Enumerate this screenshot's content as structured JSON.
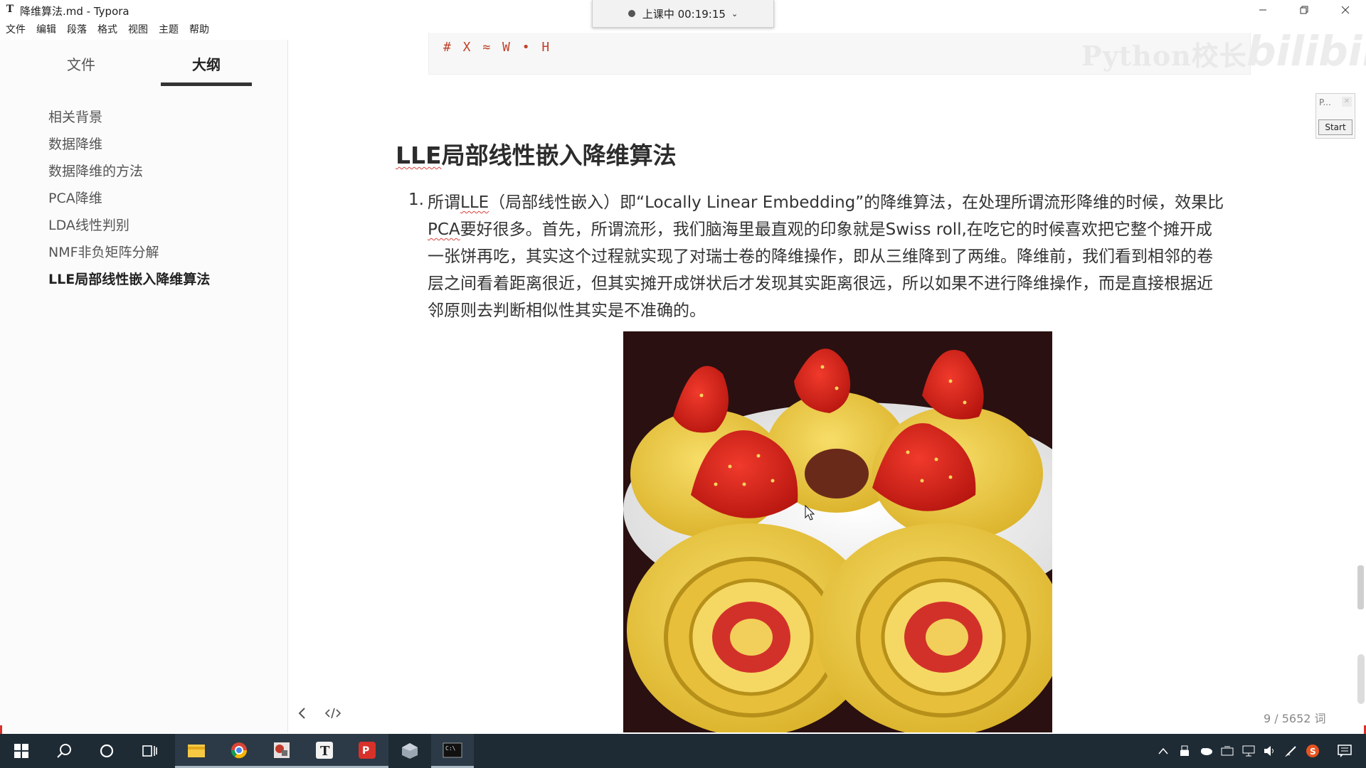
{
  "window": {
    "app_icon": "T",
    "title": "降维算法.md - Typora",
    "controls": [
      "minimize-icon",
      "restore-icon",
      "close-icon"
    ]
  },
  "session": {
    "label": "上课中 00:19:15"
  },
  "menu": [
    "文件",
    "编辑",
    "段落",
    "格式",
    "视图",
    "主题",
    "帮助"
  ],
  "sidebar": {
    "tabs": {
      "files": "文件",
      "outline": "大纲",
      "active": "outline"
    },
    "outline": [
      "相关背景",
      "数据降维",
      "数据降维的方法",
      "PCA降维",
      "LDA线性判别",
      "NMF非负矩阵分解",
      "LLE局部线性嵌入降维算法"
    ],
    "active_index": 6
  },
  "editor": {
    "code_line": "# X ≈ W • H",
    "heading": {
      "spell": "LLE",
      "rest": "局部线性嵌入降维算法"
    },
    "list_number": "1.",
    "paragraph_lines": [
      {
        "a": "所谓",
        "b": "LLE",
        "c": "（局部线性嵌入）即“Locally Linear Embedding”的降维算法，在处理所谓流形降维的时候，效果比"
      },
      {
        "a": "",
        "b": "PCA",
        "c": "要好很多。首先，所谓流形，我们脑海里最直观的印象就是Swiss roll,在吃它的时候喜欢把它整个摊开成"
      },
      {
        "a": "一张饼再吃，其实这个过程就实现了对瑞士卷的降维操作，即从三维降到了两维。降维前，我们看到相邻的卷",
        "b": "",
        "c": ""
      },
      {
        "a": "层之间看着距离很近，但其实摊开成饼状后才发现其实距离很远，所以如果不进行降维操作，而是直接根据近",
        "b": "",
        "c": ""
      },
      {
        "a": "邻原则去判断相似性其实是不准确的。",
        "b": "",
        "c": ""
      }
    ],
    "image_subject": "strawberry Swiss rolls"
  },
  "watermark": {
    "text": "Python校长",
    "logo": "bilibili"
  },
  "mini_widget": {
    "title": "P...",
    "button": "Start"
  },
  "status": {
    "left_icons": [
      "chevron-left-icon",
      "source-code-icon"
    ],
    "word_count": "9 / 5652 词"
  },
  "taskbar": {
    "apps": [
      "windows-start-icon",
      "search-icon",
      "cortana-icon",
      "task-view-icon",
      "file-explorer-icon",
      "chrome-icon",
      "paint-icon",
      "typora-icon",
      "pdf-icon",
      "virtualbox-icon",
      "terminal-icon"
    ],
    "tray": [
      "show-hidden-icon",
      "usb-icon",
      "cloud-icon",
      "tablet-icon",
      "network-icon",
      "volume-icon",
      "pen-icon",
      "sogou-ime-icon",
      "notification-icon"
    ]
  },
  "colors": {
    "accent_red": "#d8312a",
    "code_red": "#c1422a",
    "taskbar": "#1e2b35"
  }
}
